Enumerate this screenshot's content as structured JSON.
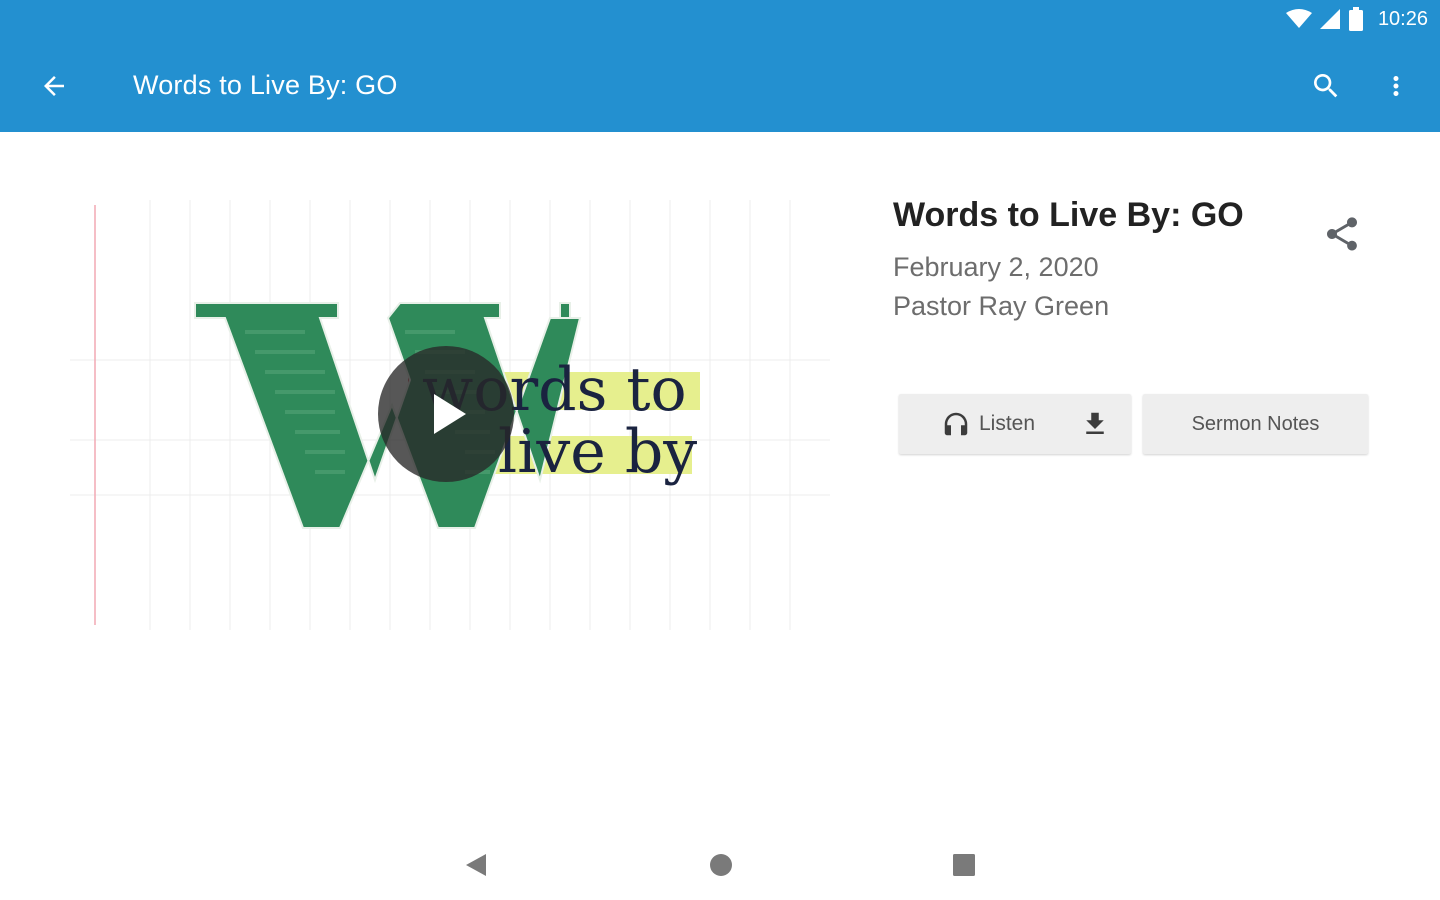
{
  "status_bar": {
    "time": "10:26",
    "icons": [
      "wifi-icon",
      "cell-signal-icon",
      "battery-icon"
    ]
  },
  "app_bar": {
    "title": "Words to Live By: GO",
    "color": "#2390d0",
    "icons": [
      "back-arrow-icon",
      "search-icon",
      "more-vert-icon"
    ]
  },
  "artwork": {
    "text_line1": "words to",
    "text_line2": "live by",
    "letter": "W",
    "colors": {
      "letter": "#2f8a5a",
      "highlight": "#e6ef8e",
      "text": "#1a2340"
    }
  },
  "sermon": {
    "title": "Words to Live By: GO",
    "date": "February 2, 2020",
    "speaker": "Pastor Ray Green"
  },
  "actions": {
    "listen_label": "Listen",
    "notes_label": "Sermon Notes",
    "icons": [
      "headphones-icon",
      "download-icon",
      "share-icon"
    ]
  },
  "nav_bar": {
    "icons": [
      "nav-back-icon",
      "nav-home-icon",
      "nav-recent-icon"
    ]
  }
}
